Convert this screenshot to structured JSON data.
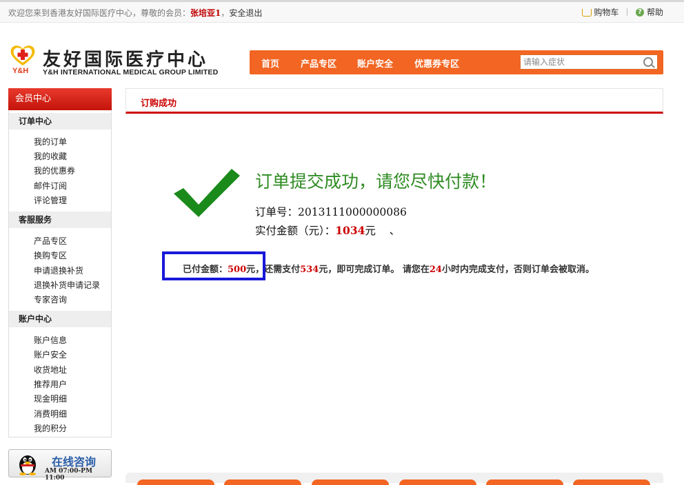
{
  "topbar": {
    "welcome_prefix": "欢迎您来到香港友好国际医疗中心，尊敬的会员：",
    "username": "张培亚1",
    "comma": "，",
    "logout": "安全退出",
    "cart": "购物车",
    "help": "帮助"
  },
  "logo": {
    "badge": "Y&H",
    "name_cn": "友好国际医疗中心",
    "name_en": "Y&H INTERNATIONAL MEDICAL GROUP LIMITED"
  },
  "nav": {
    "items": [
      "首页",
      "产品专区",
      "账户安全",
      "优惠券专区"
    ],
    "search_placeholder": "请输入症状"
  },
  "sidebar": {
    "title": "会员中心",
    "sections": [
      {
        "title": "订单中心",
        "links": [
          "我的订单",
          "我的收藏",
          "我的优惠券",
          "邮件订阅",
          "评论管理"
        ]
      },
      {
        "title": "客服服务",
        "links": [
          "产品专区",
          "换购专区",
          "申请退换补货",
          "退换补货申请记录",
          "专家咨询"
        ]
      },
      {
        "title": "账户中心",
        "links": [
          "账户信息",
          "账户安全",
          "收货地址",
          "推荐用户",
          "现金明细",
          "消费明细",
          "我的积分"
        ]
      }
    ]
  },
  "online": {
    "title": "在线咨询",
    "hours": "AM 07:00-PM 11:00"
  },
  "content": {
    "section_title": "订购成功",
    "success_message": "订单提交成功，请您尽快付款！",
    "order_label": "订单号：",
    "order_number": "2013111000000086",
    "amount_label": "实付金额（元）：",
    "amount_value": "1034",
    "amount_unit": "元",
    "amount_suffix": "、",
    "notice": {
      "paid_label": "已付金额：",
      "paid_value": "500",
      "part2": "元，还需支付",
      "remaining": "534",
      "part3": "元，即可完成订单。 请您在",
      "hours": "24",
      "part4": "小时内完成支付，否则订单会被取消。"
    }
  },
  "colors": {
    "accent": "#f26522",
    "brand_red": "#c00000",
    "success_green": "#2e8b22",
    "highlight_box": "#1818d8"
  }
}
